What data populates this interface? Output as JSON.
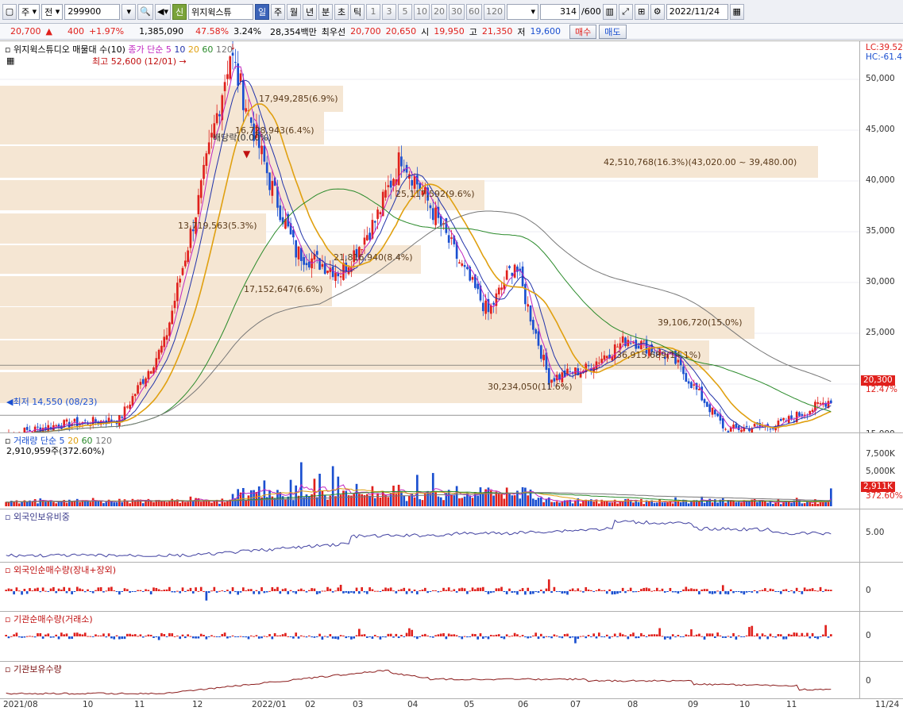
{
  "toolbar": {
    "market": "주",
    "prev_label": "전",
    "code": "299900",
    "badge_credit": "신",
    "stock_name": "위지윅스튜",
    "periods": [
      "일",
      "주",
      "월",
      "년",
      "분",
      "초",
      "틱"
    ],
    "active_period": "일",
    "intervals": [
      "1",
      "3",
      "5",
      "10",
      "20",
      "30",
      "60",
      "120"
    ],
    "count": "314",
    "count_total": "/600",
    "date": "2022/11/24"
  },
  "quote": {
    "price": "20,700",
    "change": "400",
    "change_pct": "+1.97%",
    "volume": "1,385,090",
    "vol_ratio": "47.58%",
    "turnover": "3.24%",
    "amount": "28,354백만",
    "priority_label": "최우선",
    "ask": "20,700",
    "bid": "20,650",
    "open_label": "시",
    "open": "19,950",
    "high_label": "고",
    "high": "21,350",
    "low_label": "저",
    "low": "19,600",
    "buy_label": "매수",
    "sell_label": "매도"
  },
  "price_panel": {
    "title_name": "위지윅스튜디오 매물대 수(10)",
    "title_ma": "종가 단순 5",
    "ma_periods": [
      "10",
      "20",
      "60",
      "120"
    ],
    "lc": "LC:39.52",
    "hc": "HC:-61.41",
    "high_note": "최고 52,600 (12/01)",
    "low_note": "최저 14,550 (08/23)",
    "dividend_note": "배당락(0.00%)",
    "current_price": "20,300",
    "current_pct": "12.47%",
    "yticks": [
      "50,000",
      "45,000",
      "40,000",
      "35,000",
      "30,000",
      "25,000",
      "20,000",
      "15,000"
    ],
    "volume_profile": [
      {
        "label": "17,949,285(6.9%)"
      },
      {
        "label": "16,728,943(6.4%)"
      },
      {
        "label": "42,510,768(16.3%)(43,020.00 ~ 39,480.00)"
      },
      {
        "label": "25,117,592(9.6%)"
      },
      {
        "label": "13,719,563(5.3%)"
      },
      {
        "label": "21,816,940(8.4%)"
      },
      {
        "label": "17,152,647(6.6%)"
      },
      {
        "label": "39,106,720(15.0%)"
      },
      {
        "label": "36,915,689(14.1%)"
      },
      {
        "label": "30,234,050(11.6%)"
      }
    ]
  },
  "volume_panel": {
    "title": "거래량 단순 5",
    "ma_periods": [
      "20",
      "60",
      "120"
    ],
    "value": "2,910,959주(372.60%)",
    "yticks": [
      "7,500K",
      "5,000K"
    ],
    "current": "2,911K",
    "current_pct": "372.60%"
  },
  "foreign_ratio_panel": {
    "title": "외국인보유비중",
    "ytick": "5.00"
  },
  "foreign_net_panel": {
    "title": "외국인순매수량(장내+장외)",
    "ytick": "0"
  },
  "inst_net_panel": {
    "title": "기관순매수량(거래소)",
    "ytick": "0"
  },
  "inst_hold_panel": {
    "title": "기관보유수량",
    "ytick": "0"
  },
  "xaxis": [
    "2021/08",
    "10",
    "11",
    "12",
    "2022/01",
    "02",
    "03",
    "04",
    "05",
    "06",
    "07",
    "08",
    "09",
    "10",
    "11",
    "11/24"
  ],
  "colors": {
    "up": "#e0201c",
    "down": "#1a4fd0",
    "ma5": "#c026c0",
    "ma10": "#2233aa",
    "ma20": "#e0a010",
    "ma60": "#2a8a2a",
    "ma120": "#777777",
    "profile": "#f5e6d3"
  },
  "chart_data": {
    "type": "candlestick",
    "ylim": [
      14000,
      53000
    ],
    "anchors": [
      {
        "x": "2021/08/23",
        "close": 15000
      },
      {
        "x": "2021/09",
        "close": 16000
      },
      {
        "x": "2021/10",
        "close": 24000
      },
      {
        "x": "2021/11",
        "close": 38000
      },
      {
        "x": "2021/12/01",
        "close": 52600
      },
      {
        "x": "2021/12",
        "close": 40000
      },
      {
        "x": "2022/01",
        "close": 33000
      },
      {
        "x": "2022/02",
        "close": 31000
      },
      {
        "x": "2022/03",
        "close": 36000
      },
      {
        "x": "2022/03/end",
        "close": 42500
      },
      {
        "x": "2022/04",
        "close": 38000
      },
      {
        "x": "2022/05",
        "close": 31000
      },
      {
        "x": "2022/05/end",
        "close": 27000
      },
      {
        "x": "2022/06",
        "close": 32000
      },
      {
        "x": "2022/07",
        "close": 20500
      },
      {
        "x": "2022/08",
        "close": 24500
      },
      {
        "x": "2022/09",
        "close": 22500
      },
      {
        "x": "2022/10",
        "close": 15500
      },
      {
        "x": "2022/11/24",
        "close": 20300
      }
    ]
  }
}
